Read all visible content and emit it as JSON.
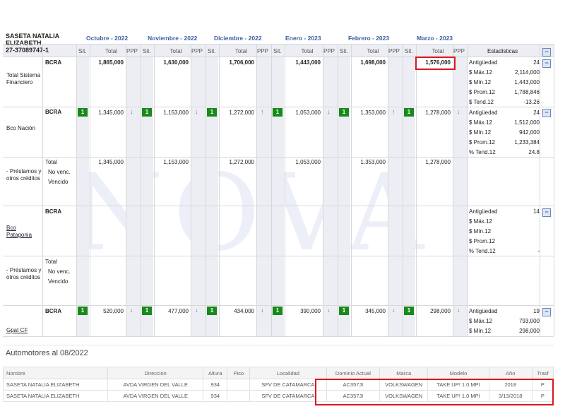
{
  "person": {
    "name": "SASETA NATALIA ELIZABETH",
    "cuit": "27-37089747-1"
  },
  "months": [
    "Octubre - 2022",
    "Noviembre - 2022",
    "Diciembre - 2022",
    "Enero - 2023",
    "Febrero - 2023",
    "Marzo - 2023"
  ],
  "col_labels": {
    "sit": "Sit.",
    "total": "Total",
    "ppp": "PPP",
    "stats": "Estadísticas"
  },
  "collapse_symbol": "−",
  "watermark": "NOVA",
  "total_sistema": {
    "label": "Total Sistema Financiero",
    "source": "BCRA",
    "totals": [
      "1,865,000",
      "1,630,000",
      "1,706,000",
      "1,443,000",
      "1,698,000",
      "1,576,000"
    ],
    "stats": [
      {
        "label": "Antigüedad",
        "value": "24"
      },
      {
        "label": "$ Máx.12",
        "value": "2,114,000"
      },
      {
        "label": "$ Mín.12",
        "value": "1,443,000"
      },
      {
        "label": "$ Prom.12",
        "value": "1,788,846"
      },
      {
        "label": "$ Tend.12",
        "value": "-13.26"
      }
    ]
  },
  "banco_nacion": {
    "label": "Bco Nación",
    "source": "BCRA",
    "sit": [
      "1",
      "1",
      "1",
      "1",
      "1",
      "1"
    ],
    "totals": [
      "1,345,000",
      "1,153,000",
      "1,272,000",
      "1,053,000",
      "1,353,000",
      "1,278,000"
    ],
    "ppp": [
      "↓",
      "↓",
      "↑",
      "↓",
      "↑",
      "↓"
    ],
    "stats": [
      {
        "label": "Antigüedad",
        "value": "24"
      },
      {
        "label": "$ Máx.12",
        "value": "1,512,000"
      },
      {
        "label": "$ Mín.12",
        "value": "942,000"
      },
      {
        "label": "$ Prom.12",
        "value": "1,233,384"
      },
      {
        "label": "% Tend.12",
        "value": "24.8"
      }
    ],
    "sub": {
      "label": "- Préstamos y otros créditos",
      "rows": [
        "Total",
        "No venc.",
        "Vencido"
      ],
      "totals": [
        "1,345,000",
        "1,153,000",
        "1,272,000",
        "1,053,000",
        "1,353,000",
        "1,278,000"
      ]
    }
  },
  "banco_patagonia": {
    "label": "Bco Patagonia",
    "source": "BCRA",
    "stats": [
      {
        "label": "Antigüedad",
        "value": "14"
      },
      {
        "label": "$ Máx.12",
        "value": ""
      },
      {
        "label": "$ Mín.12",
        "value": ""
      },
      {
        "label": "$ Prom.12",
        "value": ""
      },
      {
        "label": "% Tend.12",
        "value": "-"
      }
    ],
    "sub": {
      "label": "- Préstamos y otros créditos",
      "rows": [
        "Total",
        "No venc.",
        "Vencido"
      ]
    }
  },
  "gpat": {
    "label": "Gpat CF",
    "source": "BCRA",
    "sit": [
      "1",
      "1",
      "1",
      "1",
      "1",
      "1"
    ],
    "totals": [
      "520,000",
      "477,000",
      "434,000",
      "390,000",
      "345,000",
      "298,000"
    ],
    "ppp": [
      "↓",
      "↓",
      "↓",
      "↓",
      "↓",
      "↓"
    ],
    "stats": [
      {
        "label": "Antigüedad",
        "value": "19"
      },
      {
        "label": "$ Máx.12",
        "value": "793,000"
      },
      {
        "label": "$ Mín.12",
        "value": "298,000"
      }
    ]
  },
  "automotores": {
    "title": "Automotores al 08/2022",
    "columns": [
      "Nombre",
      "Direccion",
      "Altura",
      "Piso",
      "Localidad",
      "Dominio Actual",
      "Marca",
      "Modelo",
      "Año",
      "Trasf"
    ],
    "rows": [
      [
        "SASETA NATALIA ELIZABETH",
        "AVDA VIRGEN DEL VALLE",
        "934",
        "",
        "SFV DE CATAMARCA",
        "AC357JI",
        "VOLKSWAGEN",
        "TAKE UP! 1.0 MPI",
        "2018",
        "P"
      ],
      [
        "SASETA NATALIA ELIZABETH",
        "AVDA VIRGEN DEL VALLE",
        "934",
        "",
        "SFV DE CATAMARCA",
        "AC357JI",
        "VOLKSWAGEN",
        "TAKE UP! 1.0 MPI",
        "3/13/2018",
        "P"
      ]
    ]
  }
}
